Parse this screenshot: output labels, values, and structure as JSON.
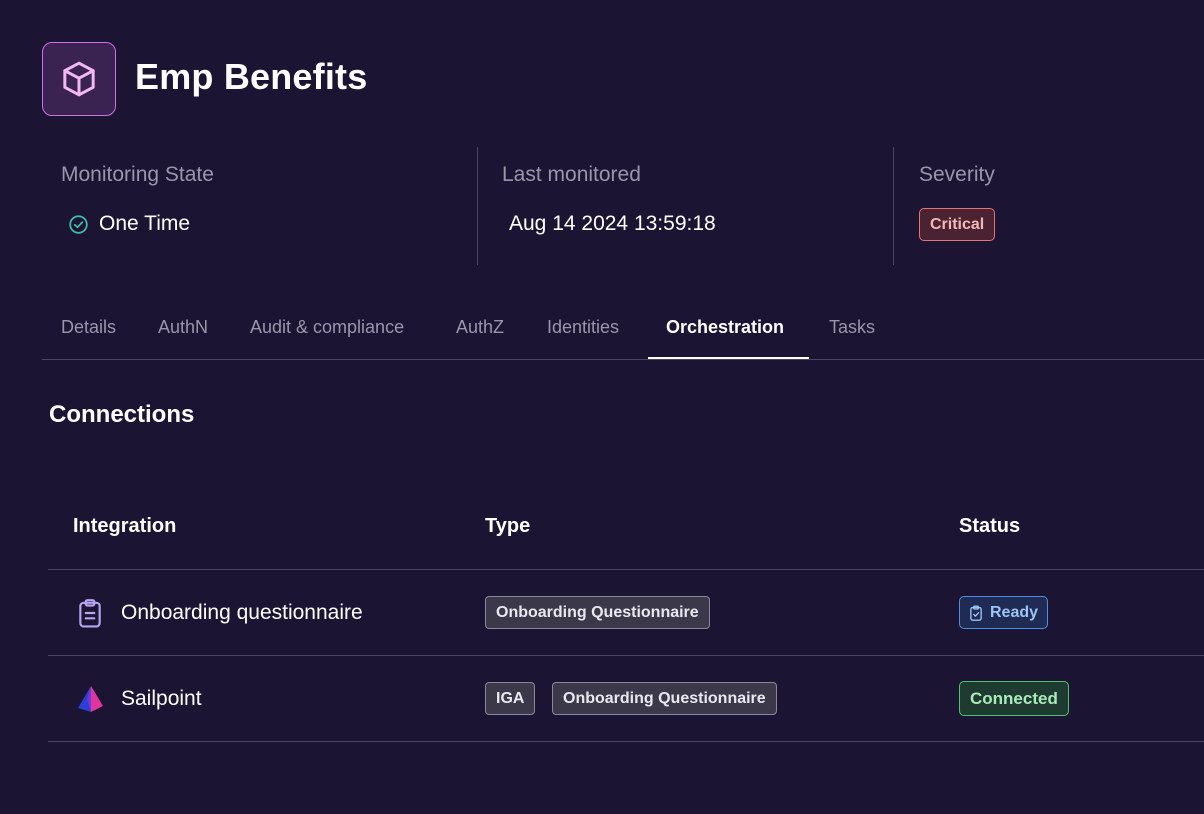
{
  "app": {
    "title": "Emp Benefits",
    "logo_icon": "cube-icon"
  },
  "meta": {
    "monitoring_state": {
      "label": "Monitoring State",
      "value": "One Time",
      "icon": "check-circle-icon"
    },
    "last_monitored": {
      "label": "Last monitored",
      "value": "Aug 14 2024 13:59:18"
    },
    "severity": {
      "label": "Severity",
      "value": "Critical",
      "color": "#e37474"
    }
  },
  "tabs": [
    {
      "label": "Details"
    },
    {
      "label": "AuthN"
    },
    {
      "label": "Audit & compliance"
    },
    {
      "label": "AuthZ"
    },
    {
      "label": "Identities"
    },
    {
      "label": "Orchestration",
      "active": true
    },
    {
      "label": "Tasks"
    }
  ],
  "connections": {
    "title": "Connections",
    "columns": [
      "Integration",
      "Type",
      "Status"
    ],
    "rows": [
      {
        "name": "Onboarding questionnaire",
        "icon": "clipboard-icon",
        "types": [
          "Onboarding Questionnaire"
        ],
        "status": "Ready",
        "status_icon": "clipboard-check-icon",
        "status_color": "#4c8fe0"
      },
      {
        "name": "Sailpoint",
        "icon": "sailpoint-logo-icon",
        "types": [
          "IGA",
          "Onboarding Questionnaire"
        ],
        "status": "Connected",
        "status_color": "#4fc36b"
      }
    ]
  },
  "colors": {
    "background": "#1b1533",
    "accent": "#d46fe0",
    "muted_text": "#9a96a9"
  }
}
